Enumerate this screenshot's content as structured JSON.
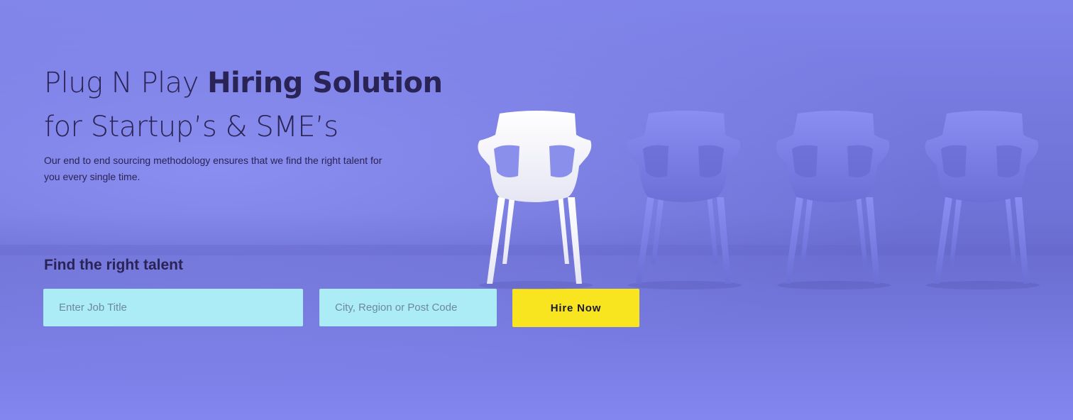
{
  "hero": {
    "headline_regular": "Plug N Play ",
    "headline_bold": "Hiring Solution",
    "headline_line2": "for Startup’s & SME’s",
    "subtext_line1": "Our end to end sourcing methodology ensures that we find the right talent for",
    "subtext_line2": "you every single time."
  },
  "search_form": {
    "title": "Find the right talent",
    "job_title_placeholder": "Enter Job Title",
    "location_placeholder": "City, Region or Post Code",
    "submit_label": "Hire Now"
  },
  "illustration": {
    "chair_icons": [
      "white-chair-icon",
      "purple-chair-icon",
      "purple-chair-icon",
      "purple-chair-icon"
    ]
  },
  "colors": {
    "background": "#7f84ea",
    "text_dark": "#2a2355",
    "input_bg": "#acecf6",
    "button_bg": "#f8e51f"
  }
}
